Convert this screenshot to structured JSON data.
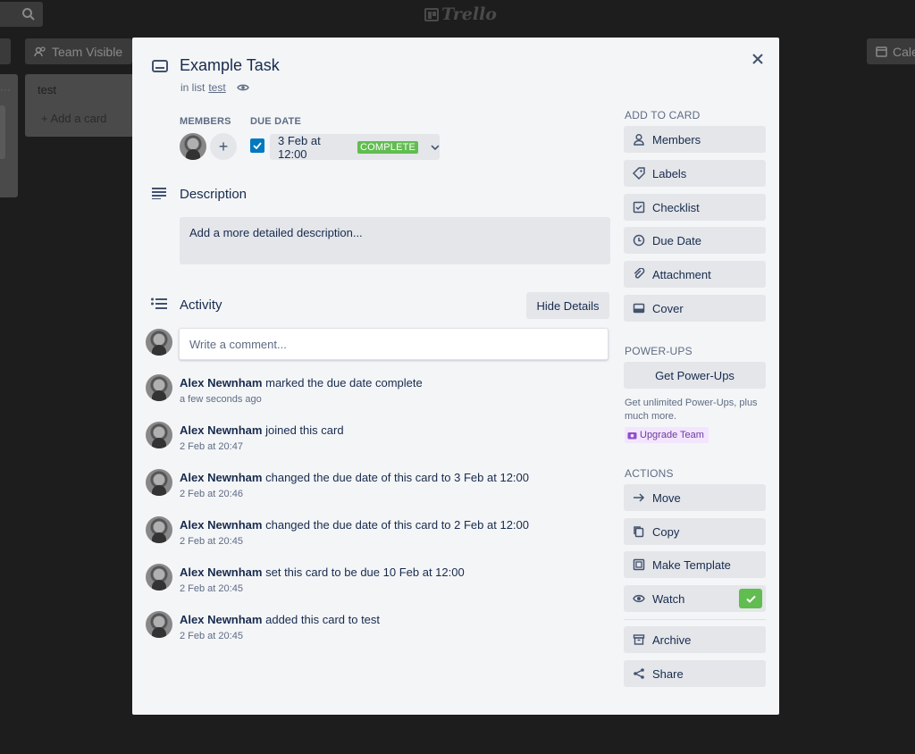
{
  "background": {
    "logo_text": "Trello",
    "team_visible_label": "Team Visible",
    "calendar_label": "Cale",
    "list_title": "test",
    "add_card_label": "Add a card"
  },
  "card": {
    "title": "Example Task",
    "in_list_prefix": "in list",
    "list_name": "test"
  },
  "members": {
    "label": "MEMBERS"
  },
  "due": {
    "label": "DUE DATE",
    "date": "3 Feb at 12:00",
    "status": "COMPLETE",
    "checked": true
  },
  "description": {
    "heading": "Description",
    "placeholder": "Add a more detailed description..."
  },
  "activity": {
    "heading": "Activity",
    "hide_details_label": "Hide Details",
    "comment_placeholder": "Write a comment...",
    "items": [
      {
        "author": "Alex Newnham",
        "action": "marked the due date complete",
        "time": "a few seconds ago"
      },
      {
        "author": "Alex Newnham",
        "action": "joined this card",
        "time": "2 Feb at 20:47"
      },
      {
        "author": "Alex Newnham",
        "action": "changed the due date of this card to 3 Feb at 12:00",
        "time": "2 Feb at 20:46"
      },
      {
        "author": "Alex Newnham",
        "action": "changed the due date of this card to 2 Feb at 12:00",
        "time": "2 Feb at 20:45"
      },
      {
        "author": "Alex Newnham",
        "action": "set this card to be due 10 Feb at 12:00",
        "time": "2 Feb at 20:45"
      },
      {
        "author": "Alex Newnham",
        "action": "added this card to test",
        "time": "2 Feb at 20:45"
      }
    ]
  },
  "sidebar": {
    "add_to_card_label": "ADD TO CARD",
    "add_to_card": [
      {
        "label": "Members",
        "icon": "person-icon"
      },
      {
        "label": "Labels",
        "icon": "tag-icon"
      },
      {
        "label": "Checklist",
        "icon": "checklist-icon"
      },
      {
        "label": "Due Date",
        "icon": "clock-icon"
      },
      {
        "label": "Attachment",
        "icon": "paperclip-icon"
      },
      {
        "label": "Cover",
        "icon": "cover-icon"
      }
    ],
    "powerups_label": "POWER-UPS",
    "get_powerups_label": "Get Power-Ups",
    "powerups_note": "Get unlimited Power-Ups, plus much more.",
    "upgrade_label": "Upgrade Team",
    "actions_label": "ACTIONS",
    "actions": [
      {
        "label": "Move",
        "icon": "arrow-right-icon"
      },
      {
        "label": "Copy",
        "icon": "copy-icon"
      },
      {
        "label": "Make Template",
        "icon": "template-icon"
      },
      {
        "label": "Watch",
        "icon": "eye-icon",
        "active": true
      },
      {
        "label": "Archive",
        "icon": "archive-icon"
      },
      {
        "label": "Share",
        "icon": "share-icon"
      }
    ]
  },
  "colors": {
    "modal_bg": "#f4f5f7",
    "button_bg": "#e4e6ea",
    "complete_green": "#61bd4f",
    "checkbox_blue": "#0079bf",
    "text_primary": "#172b4d",
    "text_subtle": "#5e6c84"
  }
}
